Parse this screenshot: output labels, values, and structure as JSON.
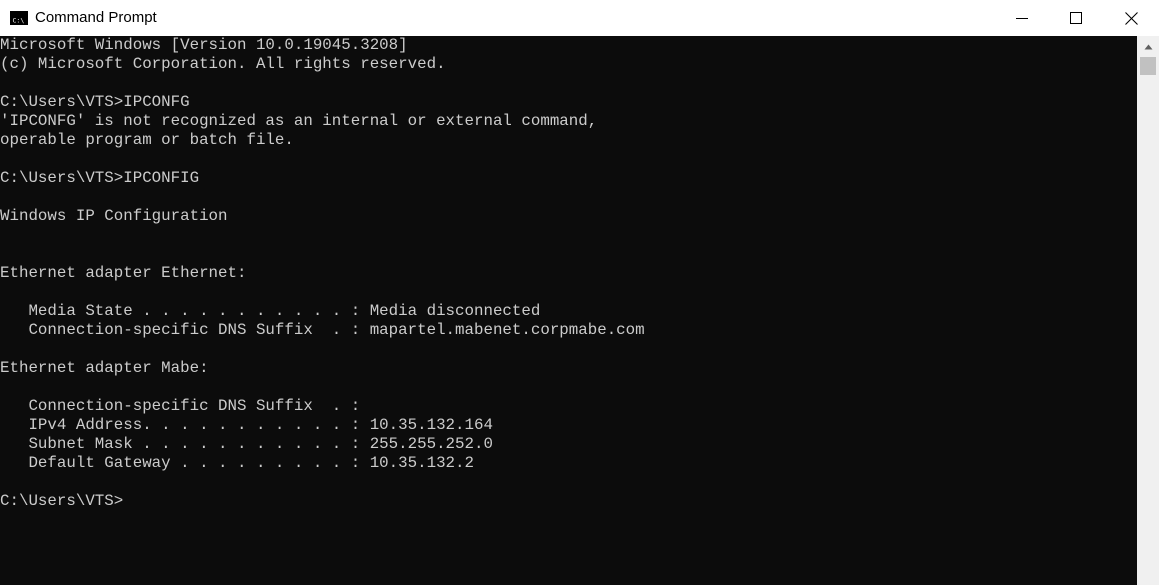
{
  "window": {
    "title": "Command Prompt",
    "icons": {
      "app": "cmd-app-icon",
      "minimize": "minimize-icon",
      "maximize": "maximize-icon",
      "close": "close-icon",
      "scroll_up": "scroll-up-arrow-icon"
    }
  },
  "console": {
    "lines": [
      "Microsoft Windows [Version 10.0.19045.3208]",
      "(c) Microsoft Corporation. All rights reserved.",
      "",
      "C:\\Users\\VTS>IPCONFG",
      "'IPCONFG' is not recognized as an internal or external command,",
      "operable program or batch file.",
      "",
      "C:\\Users\\VTS>IPCONFIG",
      "",
      "Windows IP Configuration",
      "",
      "",
      "Ethernet adapter Ethernet:",
      "",
      "   Media State . . . . . . . . . . . : Media disconnected",
      "   Connection-specific DNS Suffix  . : mapartel.mabenet.corpmabe.com",
      "",
      "Ethernet adapter Mabe:",
      "",
      "   Connection-specific DNS Suffix  . :",
      "   IPv4 Address. . . . . . . . . . . : 10.35.132.164",
      "   Subnet Mask . . . . . . . . . . . : 255.255.252.0",
      "   Default Gateway . . . . . . . . . : 10.35.132.2",
      "",
      "C:\\Users\\VTS>"
    ]
  },
  "colors": {
    "console_bg": "#0c0c0c",
    "console_text": "#cccccc",
    "titlebar_bg": "#ffffff",
    "scrollbar_bg": "#f0f0f0",
    "scrollbar_thumb": "#c1c1c1"
  }
}
